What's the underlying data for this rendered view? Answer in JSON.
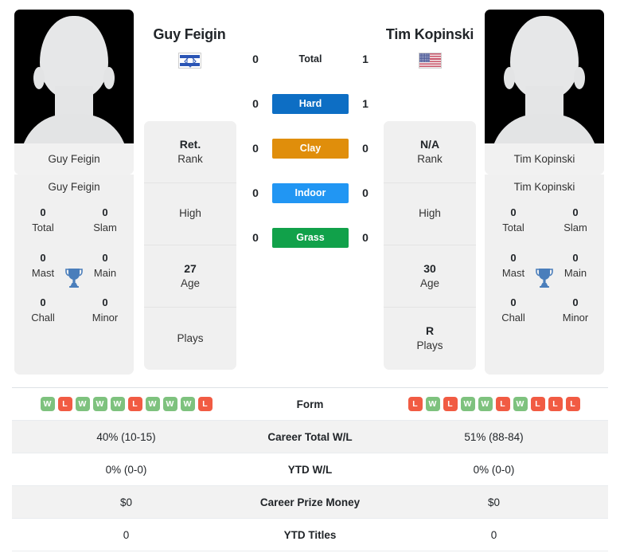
{
  "players": {
    "left": {
      "name": "Guy Feigin",
      "flag": "israel-flag",
      "photo_caption": "Guy Feigin",
      "rank": "Ret.",
      "rank_label": "Rank",
      "high": "High",
      "age": "27",
      "age_label": "Age",
      "plays": "",
      "plays_label": "Plays",
      "titles": {
        "total": "0",
        "total_label": "Total",
        "slam": "0",
        "slam_label": "Slam",
        "mast": "0",
        "mast_label": "Mast",
        "main": "0",
        "main_label": "Main",
        "chall": "0",
        "chall_label": "Chall",
        "minor": "0",
        "minor_label": "Minor"
      },
      "form": [
        "W",
        "L",
        "W",
        "W",
        "W",
        "L",
        "W",
        "W",
        "W",
        "L"
      ],
      "career_wl": "40% (10-15)",
      "ytd_wl": "0% (0-0)",
      "prize_money": "$0",
      "ytd_titles": "0"
    },
    "right": {
      "name": "Tim Kopinski",
      "flag": "usa-flag",
      "photo_caption": "Tim Kopinski",
      "rank": "N/A",
      "rank_label": "Rank",
      "high": "High",
      "age": "30",
      "age_label": "Age",
      "plays": "R",
      "plays_label": "Plays",
      "titles": {
        "total": "0",
        "total_label": "Total",
        "slam": "0",
        "slam_label": "Slam",
        "mast": "0",
        "mast_label": "Mast",
        "main": "0",
        "main_label": "Main",
        "chall": "0",
        "chall_label": "Chall",
        "minor": "0",
        "minor_label": "Minor"
      },
      "form": [
        "L",
        "W",
        "L",
        "W",
        "W",
        "L",
        "W",
        "L",
        "L",
        "L"
      ],
      "career_wl": "51% (88-84)",
      "ytd_wl": "0% (0-0)",
      "prize_money": "$0",
      "ytd_titles": "0"
    }
  },
  "head_to_head": [
    {
      "label": "Total",
      "left": "0",
      "right": "1",
      "style": "plain",
      "color": ""
    },
    {
      "label": "Hard",
      "left": "0",
      "right": "1",
      "style": "chip",
      "color": "#0d6ec4"
    },
    {
      "label": "Clay",
      "left": "0",
      "right": "0",
      "style": "chip",
      "color": "#e08e0b"
    },
    {
      "label": "Indoor",
      "left": "0",
      "right": "0",
      "style": "chip",
      "color": "#2196f3"
    },
    {
      "label": "Grass",
      "left": "0",
      "right": "0",
      "style": "chip",
      "color": "#11a14a"
    }
  ],
  "table_rows": [
    {
      "label": "Form",
      "type": "form",
      "key": "form"
    },
    {
      "label": "Career Total W/L",
      "type": "text",
      "key": "career_wl"
    },
    {
      "label": "YTD W/L",
      "type": "text",
      "key": "ytd_wl"
    },
    {
      "label": "Career Prize Money",
      "type": "text",
      "key": "prize_money"
    },
    {
      "label": "YTD Titles",
      "type": "text",
      "key": "ytd_titles"
    }
  ],
  "colors": {
    "win": "#7ec27e",
    "loss": "#f15b43",
    "card_bg": "#f0f0f0",
    "alt_row": "#f2f2f2"
  }
}
